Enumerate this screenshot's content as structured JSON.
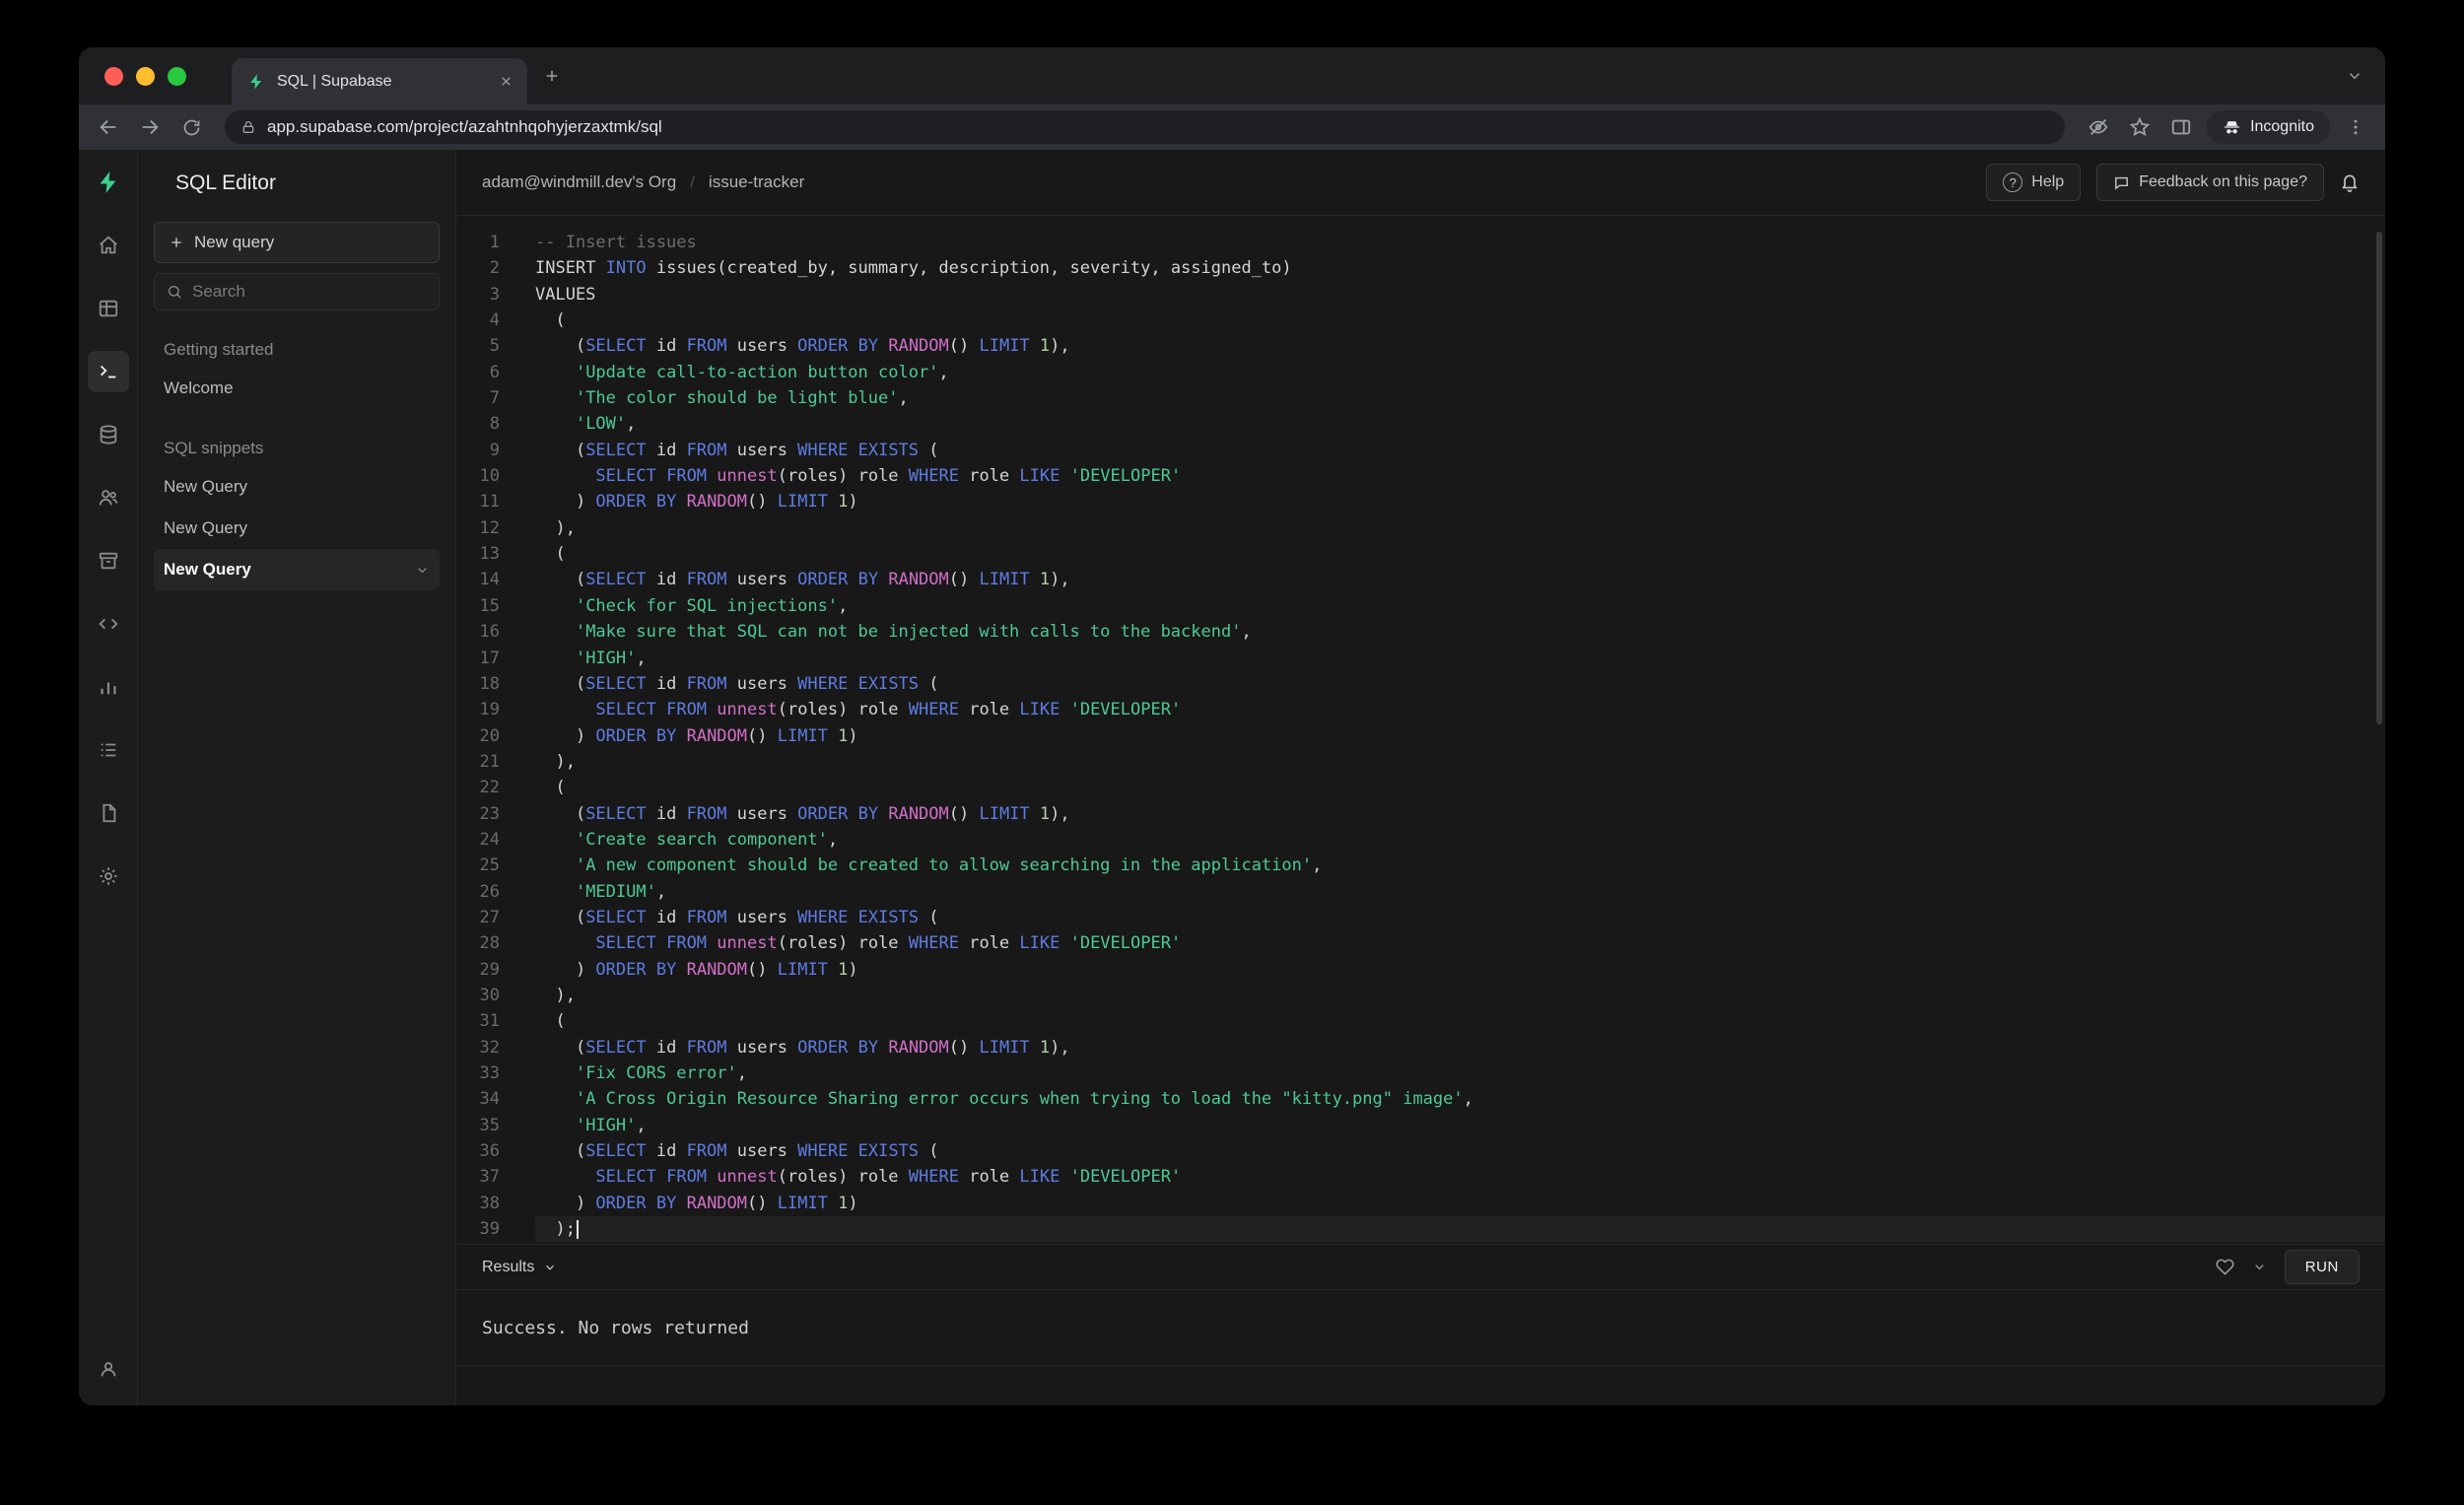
{
  "browser": {
    "tab_title": "SQL | Supabase",
    "url": "app.supabase.com/project/azahtnhqohyjerzaxtmk/sql",
    "incognito_label": "Incognito"
  },
  "rail_icons": [
    "supabase-logo",
    "home",
    "table-editor",
    "sql-editor",
    "database",
    "authentication",
    "storage",
    "api-code",
    "reports",
    "logs",
    "docs",
    "settings",
    "account"
  ],
  "sidebar": {
    "title": "SQL Editor",
    "new_query_button": "New query",
    "search_placeholder": "Search",
    "sections": [
      {
        "label": "Getting started",
        "items": [
          {
            "label": "Welcome",
            "active": false
          }
        ]
      },
      {
        "label": "SQL snippets",
        "items": [
          {
            "label": "New Query",
            "active": false
          },
          {
            "label": "New Query",
            "active": false
          },
          {
            "label": "New Query",
            "active": true
          }
        ]
      }
    ]
  },
  "header": {
    "breadcrumb_org": "adam@windmill.dev's Org",
    "breadcrumb_separator": "/",
    "breadcrumb_project": "issue-tracker",
    "help_button": "Help",
    "feedback_button": "Feedback on this page?"
  },
  "editor": {
    "cursor_line": 39,
    "lines": [
      [
        [
          "c",
          "-- Insert issues"
        ]
      ],
      [
        [
          "t",
          "INSERT "
        ],
        [
          "k",
          "INTO"
        ],
        [
          "t",
          " issues(created_by, summary, description, severity, assigned_to)"
        ]
      ],
      [
        [
          "t",
          "VALUES"
        ]
      ],
      [
        [
          "t",
          "  ("
        ]
      ],
      [
        [
          "t",
          "    ("
        ],
        [
          "k",
          "SELECT"
        ],
        [
          "t",
          " id "
        ],
        [
          "k",
          "FROM"
        ],
        [
          "t",
          " users "
        ],
        [
          "k",
          "ORDER"
        ],
        [
          "t",
          " "
        ],
        [
          "k",
          "BY"
        ],
        [
          "t",
          " "
        ],
        [
          "f",
          "RANDOM"
        ],
        [
          "t",
          "() "
        ],
        [
          "k",
          "LIMIT"
        ],
        [
          "t",
          " "
        ],
        [
          "n",
          "1"
        ],
        [
          "t",
          "),"
        ]
      ],
      [
        [
          "t",
          "    "
        ],
        [
          "s",
          "'Update call-to-action button color'"
        ],
        [
          "t",
          ","
        ]
      ],
      [
        [
          "t",
          "    "
        ],
        [
          "s",
          "'The color should be light blue'"
        ],
        [
          "t",
          ","
        ]
      ],
      [
        [
          "t",
          "    "
        ],
        [
          "s",
          "'LOW'"
        ],
        [
          "t",
          ","
        ]
      ],
      [
        [
          "t",
          "    ("
        ],
        [
          "k",
          "SELECT"
        ],
        [
          "t",
          " id "
        ],
        [
          "k",
          "FROM"
        ],
        [
          "t",
          " users "
        ],
        [
          "k",
          "WHERE"
        ],
        [
          "t",
          " "
        ],
        [
          "k",
          "EXISTS"
        ],
        [
          "t",
          " ("
        ]
      ],
      [
        [
          "t",
          "      "
        ],
        [
          "k",
          "SELECT"
        ],
        [
          "t",
          " "
        ],
        [
          "k",
          "FROM"
        ],
        [
          "t",
          " "
        ],
        [
          "f",
          "unnest"
        ],
        [
          "t",
          "(roles) role "
        ],
        [
          "k",
          "WHERE"
        ],
        [
          "t",
          " role "
        ],
        [
          "k",
          "LIKE"
        ],
        [
          "t",
          " "
        ],
        [
          "s",
          "'DEVELOPER'"
        ]
      ],
      [
        [
          "t",
          "    ) "
        ],
        [
          "k",
          "ORDER"
        ],
        [
          "t",
          " "
        ],
        [
          "k",
          "BY"
        ],
        [
          "t",
          " "
        ],
        [
          "f",
          "RANDOM"
        ],
        [
          "t",
          "() "
        ],
        [
          "k",
          "LIMIT"
        ],
        [
          "t",
          " "
        ],
        [
          "n",
          "1"
        ],
        [
          "t",
          ")"
        ]
      ],
      [
        [
          "t",
          "  ),"
        ]
      ],
      [
        [
          "t",
          "  ("
        ]
      ],
      [
        [
          "t",
          "    ("
        ],
        [
          "k",
          "SELECT"
        ],
        [
          "t",
          " id "
        ],
        [
          "k",
          "FROM"
        ],
        [
          "t",
          " users "
        ],
        [
          "k",
          "ORDER"
        ],
        [
          "t",
          " "
        ],
        [
          "k",
          "BY"
        ],
        [
          "t",
          " "
        ],
        [
          "f",
          "RANDOM"
        ],
        [
          "t",
          "() "
        ],
        [
          "k",
          "LIMIT"
        ],
        [
          "t",
          " "
        ],
        [
          "n",
          "1"
        ],
        [
          "t",
          "),"
        ]
      ],
      [
        [
          "t",
          "    "
        ],
        [
          "s",
          "'Check for SQL injections'"
        ],
        [
          "t",
          ","
        ]
      ],
      [
        [
          "t",
          "    "
        ],
        [
          "s",
          "'Make sure that SQL can not be injected with calls to the backend'"
        ],
        [
          "t",
          ","
        ]
      ],
      [
        [
          "t",
          "    "
        ],
        [
          "s",
          "'HIGH'"
        ],
        [
          "t",
          ","
        ]
      ],
      [
        [
          "t",
          "    ("
        ],
        [
          "k",
          "SELECT"
        ],
        [
          "t",
          " id "
        ],
        [
          "k",
          "FROM"
        ],
        [
          "t",
          " users "
        ],
        [
          "k",
          "WHERE"
        ],
        [
          "t",
          " "
        ],
        [
          "k",
          "EXISTS"
        ],
        [
          "t",
          " ("
        ]
      ],
      [
        [
          "t",
          "      "
        ],
        [
          "k",
          "SELECT"
        ],
        [
          "t",
          " "
        ],
        [
          "k",
          "FROM"
        ],
        [
          "t",
          " "
        ],
        [
          "f",
          "unnest"
        ],
        [
          "t",
          "(roles) role "
        ],
        [
          "k",
          "WHERE"
        ],
        [
          "t",
          " role "
        ],
        [
          "k",
          "LIKE"
        ],
        [
          "t",
          " "
        ],
        [
          "s",
          "'DEVELOPER'"
        ]
      ],
      [
        [
          "t",
          "    ) "
        ],
        [
          "k",
          "ORDER"
        ],
        [
          "t",
          " "
        ],
        [
          "k",
          "BY"
        ],
        [
          "t",
          " "
        ],
        [
          "f",
          "RANDOM"
        ],
        [
          "t",
          "() "
        ],
        [
          "k",
          "LIMIT"
        ],
        [
          "t",
          " "
        ],
        [
          "n",
          "1"
        ],
        [
          "t",
          ")"
        ]
      ],
      [
        [
          "t",
          "  ),"
        ]
      ],
      [
        [
          "t",
          "  ("
        ]
      ],
      [
        [
          "t",
          "    ("
        ],
        [
          "k",
          "SELECT"
        ],
        [
          "t",
          " id "
        ],
        [
          "k",
          "FROM"
        ],
        [
          "t",
          " users "
        ],
        [
          "k",
          "ORDER"
        ],
        [
          "t",
          " "
        ],
        [
          "k",
          "BY"
        ],
        [
          "t",
          " "
        ],
        [
          "f",
          "RANDOM"
        ],
        [
          "t",
          "() "
        ],
        [
          "k",
          "LIMIT"
        ],
        [
          "t",
          " "
        ],
        [
          "n",
          "1"
        ],
        [
          "t",
          "),"
        ]
      ],
      [
        [
          "t",
          "    "
        ],
        [
          "s",
          "'Create search component'"
        ],
        [
          "t",
          ","
        ]
      ],
      [
        [
          "t",
          "    "
        ],
        [
          "s",
          "'A new component should be created to allow searching in the application'"
        ],
        [
          "t",
          ","
        ]
      ],
      [
        [
          "t",
          "    "
        ],
        [
          "s",
          "'MEDIUM'"
        ],
        [
          "t",
          ","
        ]
      ],
      [
        [
          "t",
          "    ("
        ],
        [
          "k",
          "SELECT"
        ],
        [
          "t",
          " id "
        ],
        [
          "k",
          "FROM"
        ],
        [
          "t",
          " users "
        ],
        [
          "k",
          "WHERE"
        ],
        [
          "t",
          " "
        ],
        [
          "k",
          "EXISTS"
        ],
        [
          "t",
          " ("
        ]
      ],
      [
        [
          "t",
          "      "
        ],
        [
          "k",
          "SELECT"
        ],
        [
          "t",
          " "
        ],
        [
          "k",
          "FROM"
        ],
        [
          "t",
          " "
        ],
        [
          "f",
          "unnest"
        ],
        [
          "t",
          "(roles) role "
        ],
        [
          "k",
          "WHERE"
        ],
        [
          "t",
          " role "
        ],
        [
          "k",
          "LIKE"
        ],
        [
          "t",
          " "
        ],
        [
          "s",
          "'DEVELOPER'"
        ]
      ],
      [
        [
          "t",
          "    ) "
        ],
        [
          "k",
          "ORDER"
        ],
        [
          "t",
          " "
        ],
        [
          "k",
          "BY"
        ],
        [
          "t",
          " "
        ],
        [
          "f",
          "RANDOM"
        ],
        [
          "t",
          "() "
        ],
        [
          "k",
          "LIMIT"
        ],
        [
          "t",
          " "
        ],
        [
          "n",
          "1"
        ],
        [
          "t",
          ")"
        ]
      ],
      [
        [
          "t",
          "  ),"
        ]
      ],
      [
        [
          "t",
          "  ("
        ]
      ],
      [
        [
          "t",
          "    ("
        ],
        [
          "k",
          "SELECT"
        ],
        [
          "t",
          " id "
        ],
        [
          "k",
          "FROM"
        ],
        [
          "t",
          " users "
        ],
        [
          "k",
          "ORDER"
        ],
        [
          "t",
          " "
        ],
        [
          "k",
          "BY"
        ],
        [
          "t",
          " "
        ],
        [
          "f",
          "RANDOM"
        ],
        [
          "t",
          "() "
        ],
        [
          "k",
          "LIMIT"
        ],
        [
          "t",
          " "
        ],
        [
          "n",
          "1"
        ],
        [
          "t",
          "),"
        ]
      ],
      [
        [
          "t",
          "    "
        ],
        [
          "s",
          "'Fix CORS error'"
        ],
        [
          "t",
          ","
        ]
      ],
      [
        [
          "t",
          "    "
        ],
        [
          "s",
          "'A Cross Origin Resource Sharing error occurs when trying to load the \"kitty.png\" image'"
        ],
        [
          "t",
          ","
        ]
      ],
      [
        [
          "t",
          "    "
        ],
        [
          "s",
          "'HIGH'"
        ],
        [
          "t",
          ","
        ]
      ],
      [
        [
          "t",
          "    ("
        ],
        [
          "k",
          "SELECT"
        ],
        [
          "t",
          " id "
        ],
        [
          "k",
          "FROM"
        ],
        [
          "t",
          " users "
        ],
        [
          "k",
          "WHERE"
        ],
        [
          "t",
          " "
        ],
        [
          "k",
          "EXISTS"
        ],
        [
          "t",
          " ("
        ]
      ],
      [
        [
          "t",
          "      "
        ],
        [
          "k",
          "SELECT"
        ],
        [
          "t",
          " "
        ],
        [
          "k",
          "FROM"
        ],
        [
          "t",
          " "
        ],
        [
          "f",
          "unnest"
        ],
        [
          "t",
          "(roles) role "
        ],
        [
          "k",
          "WHERE"
        ],
        [
          "t",
          " role "
        ],
        [
          "k",
          "LIKE"
        ],
        [
          "t",
          " "
        ],
        [
          "s",
          "'DEVELOPER'"
        ]
      ],
      [
        [
          "t",
          "    ) "
        ],
        [
          "k",
          "ORDER"
        ],
        [
          "t",
          " "
        ],
        [
          "k",
          "BY"
        ],
        [
          "t",
          " "
        ],
        [
          "f",
          "RANDOM"
        ],
        [
          "t",
          "() "
        ],
        [
          "k",
          "LIMIT"
        ],
        [
          "t",
          " "
        ],
        [
          "n",
          "1"
        ],
        [
          "t",
          ")"
        ]
      ],
      [
        [
          "t",
          "  );"
        ]
      ]
    ]
  },
  "results": {
    "label": "Results",
    "run_button": "RUN",
    "message": "Success. No rows returned"
  },
  "colors": {
    "accent_green": "#3ecf8e",
    "keyword": "#5e7ce2",
    "function": "#d26fc7",
    "string": "#4ec994",
    "comment": "#6d6d6d",
    "traffic_red": "#ff5f57",
    "traffic_yellow": "#febc2e",
    "traffic_green": "#28c840"
  }
}
